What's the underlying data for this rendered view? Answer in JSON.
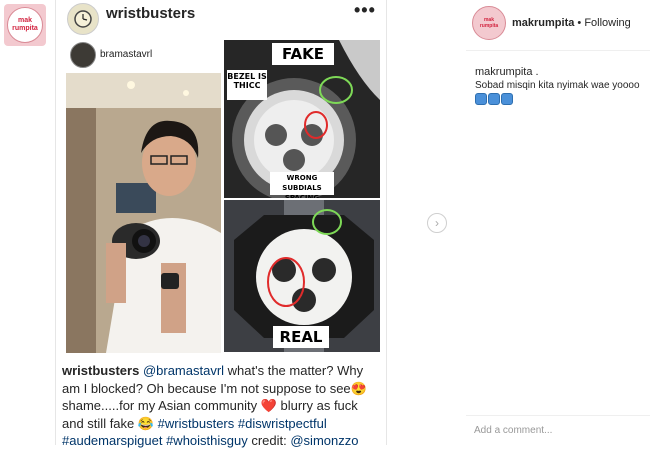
{
  "left_logo": {
    "line1": "mak",
    "line2": "rumpita"
  },
  "post": {
    "username": "wristbusters",
    "more_icon": "more-dots-icon",
    "inner_username": "bramastavrl",
    "labels": {
      "fake": "FAKE",
      "bezel": "BEZEL IS THICC",
      "subdials": "WRONG SUBDIALS SPACING",
      "real": "REAL"
    },
    "caption": {
      "user": "wristbusters",
      "mention": "@bramastavrl",
      "text1": " what's the matter? Why am I blocked? Oh because I'm not suppose to see",
      "emoji1": "😍",
      "text2": " shame.....for my Asian community ",
      "emoji2": "❤️",
      "text3": " blurry as fuck and still fake ",
      "emoji3": "😂",
      "hashtags1": " #wristbusters #diswristpectful",
      "hashtags2": "#audemarspiguet #whoisthisguy",
      "credit": " credit: ",
      "credit_user": "@simonzzo"
    }
  },
  "right_panel": {
    "avatar_line1": "mak",
    "avatar_line2": "rumpita",
    "username": "makrumpita",
    "separator": " • ",
    "follow_status": "Following",
    "comment_user": "makrumpita .",
    "comment_text": "Sobad misqin kita nyimak wae yoooo",
    "add_comment_placeholder": "Add a comment..."
  },
  "nav_icon": "chevron-right-icon",
  "colors": {
    "link": "#003569",
    "accent_pink": "#d2233f",
    "circle_green": "#7ed957",
    "circle_red": "#e02b2b"
  }
}
